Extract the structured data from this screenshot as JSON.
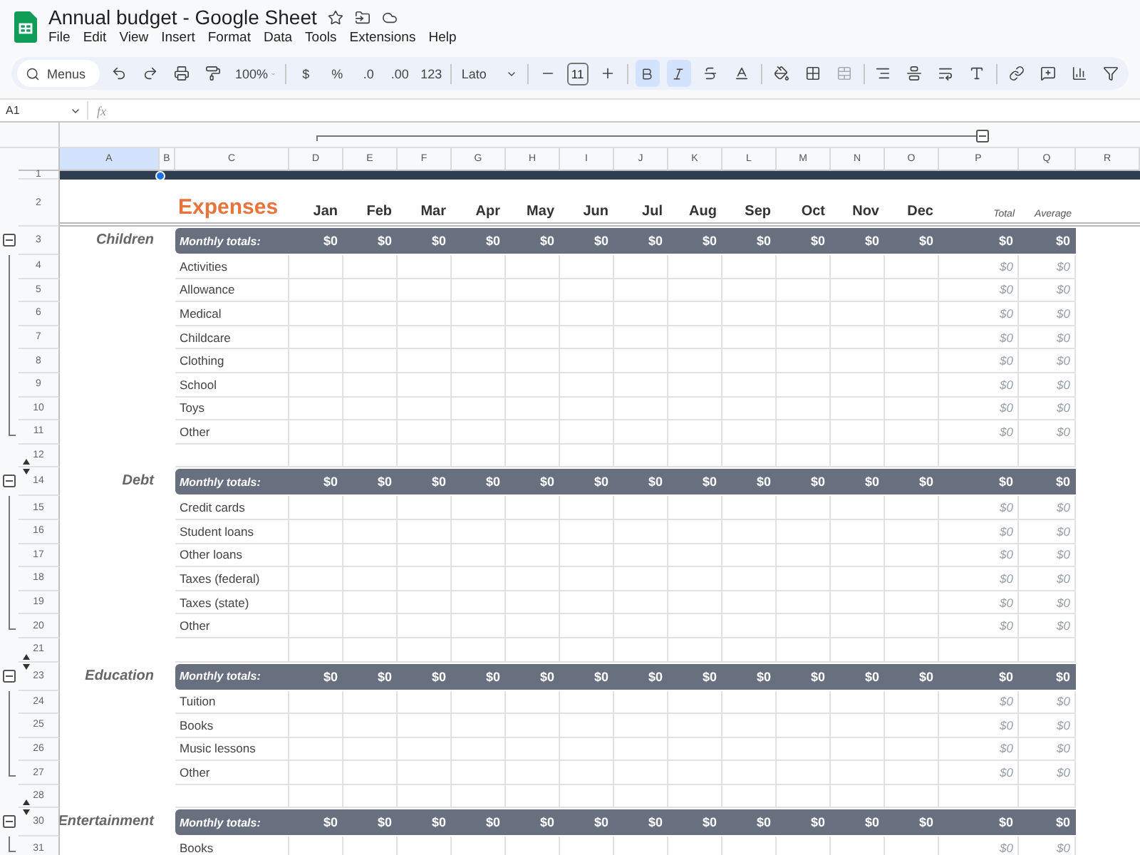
{
  "document": {
    "title": "Annual budget - Google Sheet"
  },
  "menu": [
    "File",
    "Edit",
    "View",
    "Insert",
    "Format",
    "Data",
    "Tools",
    "Extensions",
    "Help"
  ],
  "toolbar": {
    "search_placeholder": "Menus",
    "zoom": "100%",
    "currency": "$",
    "percent": "%",
    "decimal_decrease": ".0",
    "decimal_increase": ".00",
    "number_format": "123",
    "font": "Lato",
    "font_size": "11",
    "bold": true,
    "italic": true,
    "merge_disabled": true
  },
  "formula_bar": {
    "cell": "A1",
    "label": "fx"
  },
  "columns": [
    {
      "label": "A",
      "selected": true
    },
    {
      "label": "B",
      "selected": false
    },
    {
      "label": "C",
      "selected": false
    },
    {
      "label": "D",
      "selected": false
    },
    {
      "label": "E",
      "selected": false
    },
    {
      "label": "F",
      "selected": false
    },
    {
      "label": "G",
      "selected": false
    },
    {
      "label": "H",
      "selected": false
    },
    {
      "label": "I",
      "selected": false
    },
    {
      "label": "J",
      "selected": false
    },
    {
      "label": "K",
      "selected": false
    },
    {
      "label": "L",
      "selected": false
    },
    {
      "label": "M",
      "selected": false
    },
    {
      "label": "N",
      "selected": false
    },
    {
      "label": "O",
      "selected": false
    },
    {
      "label": "P",
      "selected": false
    },
    {
      "label": "Q",
      "selected": false
    },
    {
      "label": "R",
      "selected": false
    }
  ],
  "band_row": {
    "number": "1"
  },
  "heading_row": {
    "number": "2",
    "title": "Expenses",
    "months": [
      "Jan",
      "Feb",
      "Mar",
      "Apr",
      "May",
      "Jun",
      "Jul",
      "Aug",
      "Sep",
      "Oct",
      "Nov",
      "Dec"
    ],
    "total": "Total",
    "average": "Average"
  },
  "sections": [
    {
      "number": "3",
      "category": "Children",
      "label": "Monthly totals:",
      "months": [
        "$0",
        "$0",
        "$0",
        "$0",
        "$0",
        "$0",
        "$0",
        "$0",
        "$0",
        "$0",
        "$0",
        "$0"
      ],
      "total": "$0",
      "average": "$0",
      "hidden_before": false,
      "expanded": true,
      "items": [
        {
          "number": "4",
          "label": "Activities",
          "total": "$0",
          "average": "$0"
        },
        {
          "number": "5",
          "label": "Allowance",
          "total": "$0",
          "average": "$0"
        },
        {
          "number": "6",
          "label": "Medical",
          "total": "$0",
          "average": "$0"
        },
        {
          "number": "7",
          "label": "Childcare",
          "total": "$0",
          "average": "$0"
        },
        {
          "number": "8",
          "label": "Clothing",
          "total": "$0",
          "average": "$0"
        },
        {
          "number": "9",
          "label": "School",
          "total": "$0",
          "average": "$0"
        },
        {
          "number": "10",
          "label": "Toys",
          "total": "$0",
          "average": "$0"
        },
        {
          "number": "11",
          "label": "Other",
          "total": "$0",
          "average": "$0"
        }
      ],
      "spacer": {
        "number": "12",
        "hidden_after": true
      }
    },
    {
      "number": "14",
      "category": "Debt",
      "label": "Monthly totals:",
      "months": [
        "$0",
        "$0",
        "$0",
        "$0",
        "$0",
        "$0",
        "$0",
        "$0",
        "$0",
        "$0",
        "$0",
        "$0"
      ],
      "total": "$0",
      "average": "$0",
      "hidden_before": true,
      "expanded": true,
      "items": [
        {
          "number": "15",
          "label": "Credit cards",
          "total": "$0",
          "average": "$0"
        },
        {
          "number": "16",
          "label": "Student loans",
          "total": "$0",
          "average": "$0"
        },
        {
          "number": "17",
          "label": "Other loans",
          "total": "$0",
          "average": "$0"
        },
        {
          "number": "18",
          "label": "Taxes (federal)",
          "total": "$0",
          "average": "$0"
        },
        {
          "number": "19",
          "label": "Taxes (state)",
          "total": "$0",
          "average": "$0"
        },
        {
          "number": "20",
          "label": "Other",
          "total": "$0",
          "average": "$0"
        }
      ],
      "spacer": {
        "number": "21",
        "hidden_after": true
      }
    },
    {
      "number": "23",
      "category": "Education",
      "label": "Monthly totals:",
      "months": [
        "$0",
        "$0",
        "$0",
        "$0",
        "$0",
        "$0",
        "$0",
        "$0",
        "$0",
        "$0",
        "$0",
        "$0"
      ],
      "total": "$0",
      "average": "$0",
      "hidden_before": true,
      "expanded": true,
      "items": [
        {
          "number": "24",
          "label": "Tuition",
          "total": "$0",
          "average": "$0"
        },
        {
          "number": "25",
          "label": "Books",
          "total": "$0",
          "average": "$0"
        },
        {
          "number": "26",
          "label": "Music lessons",
          "total": "$0",
          "average": "$0"
        },
        {
          "number": "27",
          "label": "Other",
          "total": "$0",
          "average": "$0"
        }
      ],
      "spacer": {
        "number": "28",
        "hidden_after": true
      }
    },
    {
      "number": "30",
      "category": "Entertainment",
      "label": "Monthly totals:",
      "months": [
        "$0",
        "$0",
        "$0",
        "$0",
        "$0",
        "$0",
        "$0",
        "$0",
        "$0",
        "$0",
        "$0",
        "$0"
      ],
      "total": "$0",
      "average": "$0",
      "hidden_before": true,
      "expanded": true,
      "items": [
        {
          "number": "31",
          "label": "Books",
          "total": "$0",
          "average": "$0"
        }
      ]
    }
  ]
}
